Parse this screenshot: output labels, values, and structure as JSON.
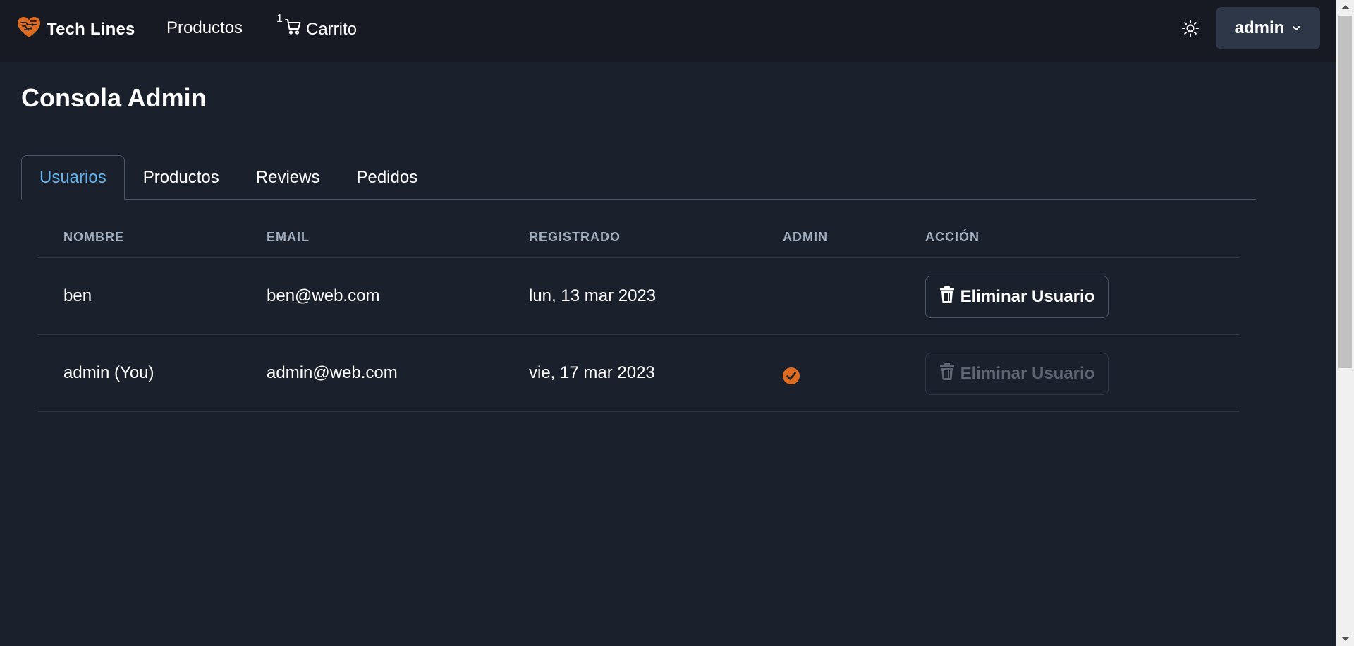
{
  "nav": {
    "brand": "Tech Lines",
    "products": "Productos",
    "cart_label": "Carrito",
    "cart_count": "1",
    "user": "admin"
  },
  "page": {
    "title": "Consola Admin"
  },
  "tabs": [
    {
      "label": "Usuarios",
      "active": true
    },
    {
      "label": "Productos",
      "active": false
    },
    {
      "label": "Reviews",
      "active": false
    },
    {
      "label": "Pedidos",
      "active": false
    }
  ],
  "table": {
    "headers": [
      "NOMBRE",
      "EMAIL",
      "REGISTRADO",
      "ADMIN",
      "ACCIÓN"
    ],
    "rows": [
      {
        "name": "ben",
        "email": "ben@web.com",
        "registered": "lun, 13 mar 2023",
        "is_admin": false,
        "action": "Eliminar Usuario",
        "action_enabled": true
      },
      {
        "name": "admin (You)",
        "email": "admin@web.com",
        "registered": "vie, 17 mar 2023",
        "is_admin": true,
        "action": "Eliminar Usuario",
        "action_enabled": false
      }
    ]
  },
  "colors": {
    "background": "#1a202c",
    "navbar": "#171923",
    "accent_tab": "#63b3ed",
    "brand_orange": "#dd6b20",
    "admin_check": "#dd6b20"
  },
  "icons": {
    "brand": "heart-circuit-icon",
    "cart": "cart-icon",
    "theme": "sun-icon",
    "user_menu": "chevron-down-icon",
    "delete": "trash-icon",
    "admin": "check-circle-icon"
  }
}
